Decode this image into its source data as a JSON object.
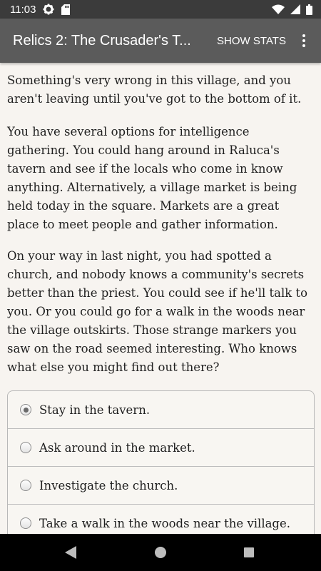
{
  "status_bar": {
    "time": "11:03",
    "icons_left": [
      "gear-icon",
      "sd-card-icon"
    ],
    "icons_right": [
      "wifi-icon",
      "signal-icon",
      "battery-icon"
    ]
  },
  "app_bar": {
    "title": "Relics 2: The Crusader's T...",
    "show_stats_label": "SHOW STATS",
    "overflow_icon": "overflow-menu-icon"
  },
  "story": {
    "paragraphs": [
      "Something's very wrong in this village, and you aren't leaving until you've got to the bottom of it.",
      "You have several options for intelligence gathering. You could hang around in Raluca's tavern and see if the locals who come in know anything. Alternatively, a village market is being held today in the square. Markets are a great place to meet people and gather information.",
      "On your way in last night, you had spotted a church, and nobody knows a community's secrets better than the priest. You could see if he'll talk to you. Or you could go for a walk in the woods near the village outskirts. Those strange markers you saw on the road seemed interesting. Who knows what else you might find out there?"
    ]
  },
  "choices": [
    {
      "label": "Stay in the tavern.",
      "selected": true
    },
    {
      "label": "Ask around in the market.",
      "selected": false
    },
    {
      "label": "Investigate the church.",
      "selected": false
    },
    {
      "label": "Take a walk in the woods near the village.",
      "selected": false
    }
  ],
  "nav_bar": {
    "buttons": [
      "back-icon",
      "home-icon",
      "recents-icon"
    ]
  },
  "colors": {
    "status_bar": "#3b3b3b",
    "app_bar": "#5b5b5b",
    "background": "#f7f4f0",
    "nav_bar": "#000000"
  }
}
